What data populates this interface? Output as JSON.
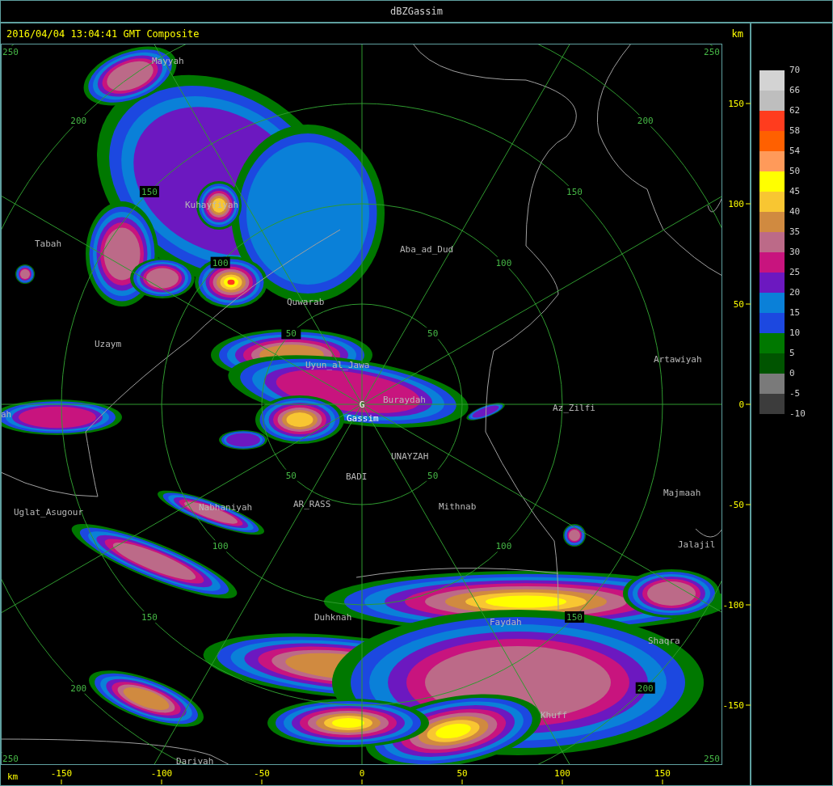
{
  "window": {
    "title": "dBZGassim"
  },
  "header": {
    "timestamp": "2016/04/04 13:04:41 GMT Composite",
    "unit": "km"
  },
  "range_rings": [
    {
      "labels": [
        "50",
        "50",
        "50",
        "50"
      ]
    },
    {
      "labels": [
        "100",
        "100",
        "100",
        "100"
      ]
    },
    {
      "labels": [
        "150",
        "150",
        "150",
        "150"
      ]
    },
    {
      "labels": [
        "200",
        "200",
        "200",
        "200"
      ]
    },
    {
      "labels": [
        "250",
        "250",
        "250",
        "250"
      ]
    }
  ],
  "places": [
    {
      "name": "Mayyah",
      "kind": "town"
    },
    {
      "name": "Kuhayfiyah",
      "kind": "town"
    },
    {
      "name": "Tabah",
      "kind": "town"
    },
    {
      "name": "Aba_ad_Dud",
      "kind": "town"
    },
    {
      "name": "Quwarab",
      "kind": "town"
    },
    {
      "name": "Uzaym",
      "kind": "town"
    },
    {
      "name": "Uyun_al_Jawa",
      "kind": "town"
    },
    {
      "name": "Artawiyah",
      "kind": "town"
    },
    {
      "name": "Buraydah",
      "kind": "town"
    },
    {
      "name": "Az_Zilfi",
      "kind": "town"
    },
    {
      "name": "ah",
      "kind": "town"
    },
    {
      "name": "Gassim",
      "kind": "radar",
      "marker": "G"
    },
    {
      "name": "UNAYZAH",
      "kind": "town"
    },
    {
      "name": "BADI",
      "kind": "town"
    },
    {
      "name": "Uglat_Asugour",
      "kind": "town"
    },
    {
      "name": "Nabhaniyah",
      "kind": "town"
    },
    {
      "name": "AR_RASS",
      "kind": "town"
    },
    {
      "name": "Mithnab",
      "kind": "town"
    },
    {
      "name": "Majmaah",
      "kind": "town"
    },
    {
      "name": "Jalajil",
      "kind": "town"
    },
    {
      "name": "Duhknah",
      "kind": "town"
    },
    {
      "name": "Faydah",
      "kind": "town"
    },
    {
      "name": "Shaqra",
      "kind": "town"
    },
    {
      "name": "Khuff",
      "kind": "town"
    },
    {
      "name": "Dariyah",
      "kind": "town"
    }
  ],
  "y_axis": {
    "ticks": [
      "150",
      "100",
      "50",
      "0",
      "-50",
      "-100",
      "-150"
    ]
  },
  "x_axis": {
    "unit": "km",
    "ticks": [
      "-150",
      "-100",
      "-50",
      "0",
      "50",
      "100",
      "150"
    ]
  },
  "legend": {
    "swatches": [
      {
        "color": "#d3d3d3"
      },
      {
        "color": "#bebebe"
      },
      {
        "color": "#ff3c1e"
      },
      {
        "color": "#ff6000"
      },
      {
        "color": "#ff9a5a"
      },
      {
        "color": "#ffff00"
      },
      {
        "color": "#f8c632"
      },
      {
        "color": "#d08a40"
      },
      {
        "color": "#bc6a88"
      },
      {
        "color": "#c8147e"
      },
      {
        "color": "#6c18c0"
      },
      {
        "color": "#0a80d8"
      },
      {
        "color": "#1c48e0"
      },
      {
        "color": "#007800"
      },
      {
        "color": "#005400"
      },
      {
        "color": "#7a7a7a"
      },
      {
        "color": "#3c3c3c"
      }
    ],
    "labels": [
      "70",
      "66",
      "62",
      "58",
      "54",
      "50",
      "45",
      "40",
      "35",
      "30",
      "25",
      "20",
      "15",
      "10",
      "5",
      "0",
      "-5",
      "-10"
    ]
  }
}
